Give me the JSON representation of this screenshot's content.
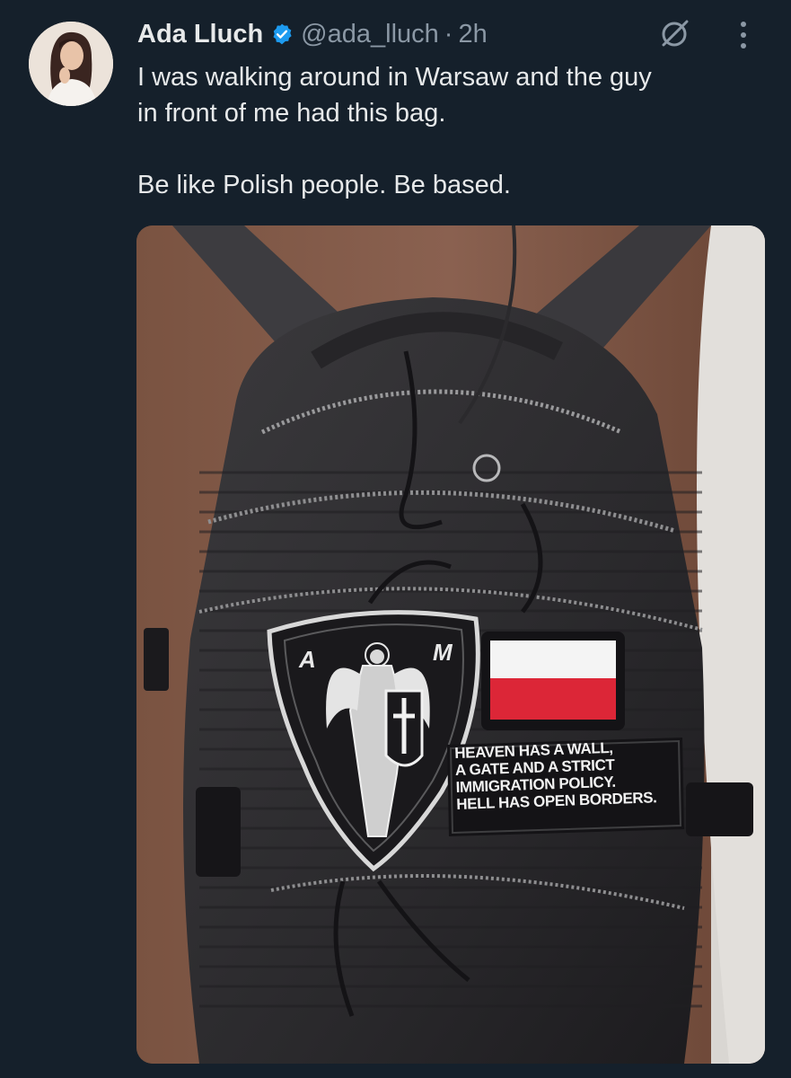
{
  "author": {
    "display_name": "Ada Lluch",
    "handle": "@ada_lluch",
    "separator": "·",
    "time": "2h"
  },
  "tweet": {
    "line1": "I was walking around in Warsaw and the guy",
    "line2": "in front of me had this bag.",
    "line3": "Be like Polish people. Be based."
  },
  "media": {
    "patch_letters": [
      "A",
      "M"
    ],
    "patch_text": [
      "HEAVEN HAS A WALL,",
      "A GATE AND A STRICT",
      "IMMIGRATION POLICY.",
      "HELL HAS OPEN BORDERS."
    ],
    "flag_colors": [
      "#f4f4f4",
      "#dc2637"
    ]
  },
  "icons": {
    "verified": "verified-badge-icon",
    "grok": "grok-icon",
    "more": "more-options-icon"
  },
  "colors": {
    "background": "#15202b",
    "text": "#e7e9ea",
    "secondary_text": "#8b98a5",
    "verified_blue": "#1d9bf0"
  }
}
